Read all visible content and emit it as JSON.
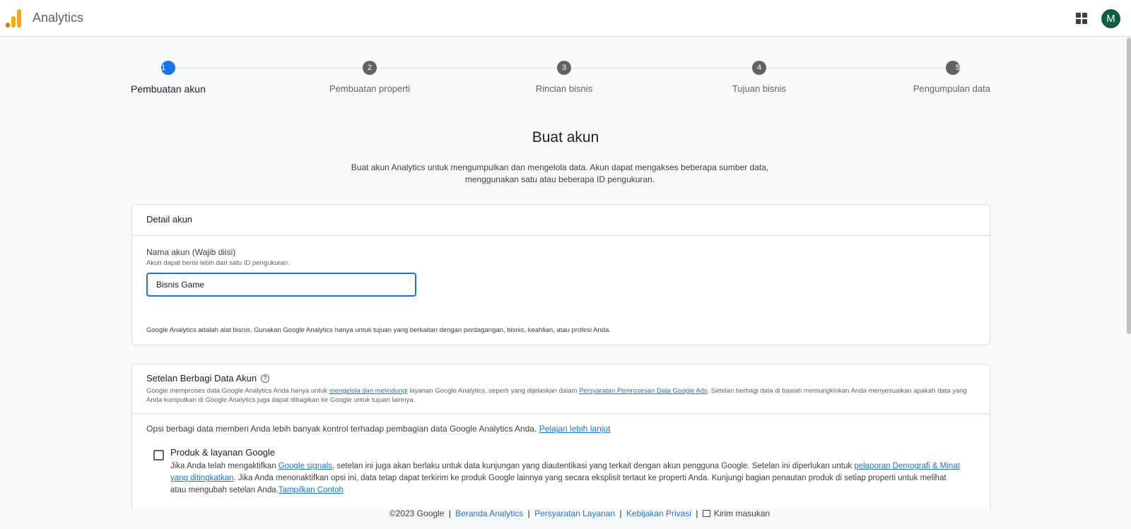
{
  "header": {
    "app_title": "Analytics",
    "avatar_letter": "M",
    "logo_colors": [
      "#e37400",
      "#f9ab00",
      "#f9ab00"
    ]
  },
  "stepper": {
    "steps": [
      {
        "number": "1",
        "label": "Pembuatan akun",
        "active": true
      },
      {
        "number": "2",
        "label": "Pembuatan properti",
        "active": false
      },
      {
        "number": "3",
        "label": "Rincian bisnis",
        "active": false
      },
      {
        "number": "4",
        "label": "Tujuan bisnis",
        "active": false
      },
      {
        "number": "5",
        "label": "Pengumpulan data",
        "active": false
      }
    ]
  },
  "page": {
    "title": "Buat akun",
    "description": "Buat akun Analytics untuk mengumpulkan dan mengelola data. Akun dapat mengakses beberapa sumber data, menggunakan satu atau beberapa ID pengukuran."
  },
  "account_details": {
    "heading": "Detail akun",
    "field_label": "Nama akun (Wajib diisi)",
    "field_help": "Akun dapat berisi lebih dari satu ID pengukuran.",
    "field_value": "Bisnis Game",
    "note": "Google Analytics adalah alat bisnis. Gunakan Google Analytics hanya untuk tujuan yang berkaitan dengan perdagangan, bisnis, keahlian, atau profesi Anda."
  },
  "sharing": {
    "heading": "Setelan Berbagi Data Akun",
    "help_icon": "help-circle-icon",
    "desc_part1": "Google memproses data Google Analytics Anda hanya untuk ",
    "desc_link1": "mengelola dan melindungi",
    "desc_part2": " layanan Google Analytics, seperti yang dijelaskan dalam ",
    "desc_link2": "Persyaratan Pemrosesan Data Google Ads",
    "desc_part3": ". Setelan berbagi data di bawah memungkinkan Anda menyesuaikan apakah data yang Anda kumpulkan di Google Analytics juga dapat dibagikan ke Google untuk tujuan lainnya.",
    "options_text": "Opsi berbagi data memberi Anda lebih banyak kontrol terhadap pembagian data Google Analytics Anda. ",
    "options_link": "Pelajari lebih lanjut",
    "product": {
      "title": "Produk & layanan Google",
      "checked": false,
      "p1": "Jika Anda telah mengaktifkan ",
      "link1": "Google signals",
      "p2": ", setelan ini juga akan berlaku untuk data kunjungan yang diautentikasi yang terkait dengan akun pengguna Google. Setelan ini diperlukan untuk ",
      "link2": "pelaporan Demografi & Minat yang ditingkatkan",
      "p3": ". Jika Anda menonaktifkan opsi ini, data tetap dapat terkirim ke produk Google lainnya yang secara eksplisit tertaut ke properti Anda. Kunjungi bagian penautan produk di setiap properti untuk melihat atau mengubah setelan Anda.",
      "link3": "Tampilkan Contoh"
    }
  },
  "footer": {
    "copyright": "©2023 Google",
    "link1": "Beranda Analytics",
    "link2": "Persyaratan Layanan",
    "link3": "Kebijakan Privasi",
    "feedback": "Kirim masukan",
    "separator": "|"
  },
  "colors": {
    "accent": "#1a73e8",
    "avatar_bg": "#0d5c46"
  }
}
